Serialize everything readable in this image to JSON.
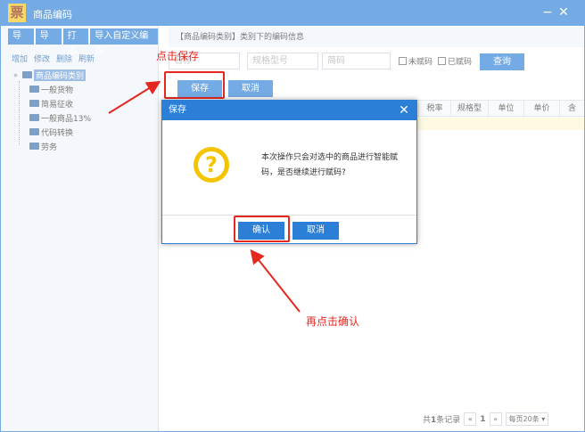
{
  "window": {
    "logo_char": "票",
    "title": "商品编码",
    "minimize": "−",
    "close": "✕"
  },
  "toolbar": {
    "import": "导入",
    "export": "导出",
    "print": "打印",
    "import_custom": "导入自定义编码"
  },
  "tree_actions": {
    "add": "增加",
    "edit": "修改",
    "delete": "删除",
    "refresh": "刷新"
  },
  "tree": {
    "root": "商品编码类别",
    "items": [
      "一般货物",
      "简易征收",
      "一般商品13%",
      "代码转换",
      "劳务"
    ]
  },
  "header": {
    "category_text": "【商品编码类别】类别下的编码信息"
  },
  "filters": {
    "name_placeholder": "名称",
    "model_placeholder": "规格型号",
    "short_code_placeholder": "简码",
    "unassigned_label": "未赋码",
    "assigned_label": "已赋码",
    "query_button": "查询"
  },
  "actions": {
    "save": "保存",
    "cancel": "取消"
  },
  "table": {
    "columns": [
      "税率",
      "规格型",
      "单位",
      "单价",
      "含"
    ]
  },
  "pager": {
    "total_prefix": "共",
    "total_count": "1",
    "total_suffix": "条记录",
    "prev": "«",
    "current_page": "1",
    "next": "»",
    "page_size": "每页20条"
  },
  "dialog": {
    "title": "保存",
    "close": "✕",
    "icon_char": "?",
    "message": "本次操作只会对选中的商品进行智能赋码，是否继续进行赋码?",
    "confirm": "确认",
    "cancel": "取消"
  },
  "annotations": {
    "click_save": "点击保存",
    "then_confirm": "再点击确认",
    "color": "#e4281f"
  },
  "colors": {
    "primary": "#2c7fd6",
    "warning": "#f5c400"
  }
}
